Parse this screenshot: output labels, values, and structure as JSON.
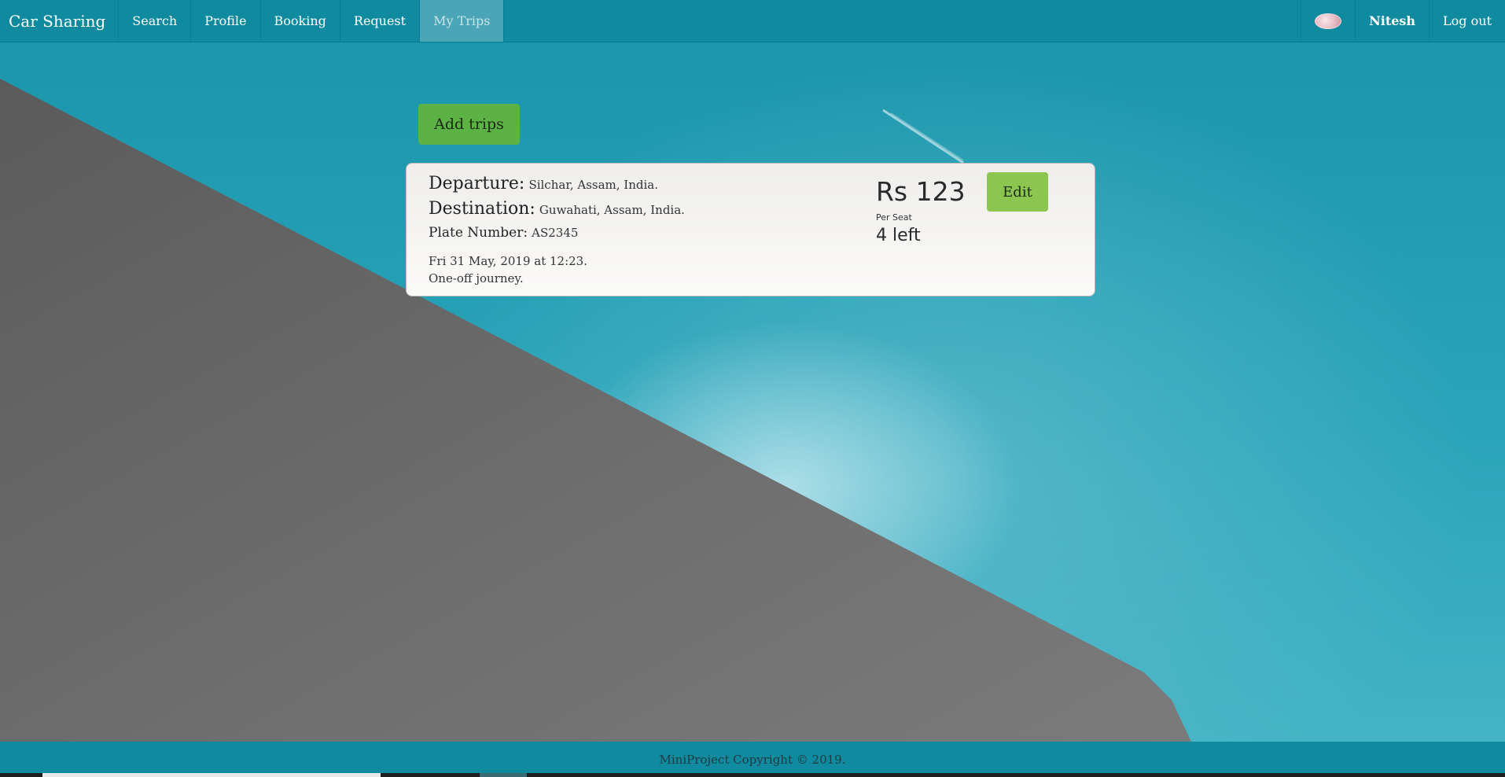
{
  "nav": {
    "brand": "Car Sharing",
    "items": [
      {
        "label": "Search",
        "active": false
      },
      {
        "label": "Profile",
        "active": false
      },
      {
        "label": "Booking",
        "active": false
      },
      {
        "label": "Request",
        "active": false
      },
      {
        "label": "My Trips",
        "active": true
      }
    ],
    "user": {
      "name": "Nitesh",
      "avatar_icon": "avatar-image"
    },
    "logout_label": "Log out"
  },
  "main": {
    "add_trips_label": "Add trips",
    "trip": {
      "departure_label": "Departure:",
      "departure_value": "Silchar, Assam, India.",
      "destination_label": "Destination:",
      "destination_value": "Guwahati, Assam, India.",
      "plate_label": "Plate Number:",
      "plate_value": "AS2345",
      "datetime": "Fri 31 May, 2019 at 12:23.",
      "journey_type": "One-off journey.",
      "price": "Rs 123",
      "per_seat_label": "Per Seat",
      "seats_left": "4 left",
      "edit_label": "Edit"
    }
  },
  "footer": {
    "text": "MiniProject Copyright © 2019."
  },
  "colors": {
    "navbar": "#0f8a9e",
    "add_button": "#5cb244",
    "edit_button": "#8cc650",
    "sky": "#2aa4b9",
    "wall": "#6e6e6e"
  }
}
